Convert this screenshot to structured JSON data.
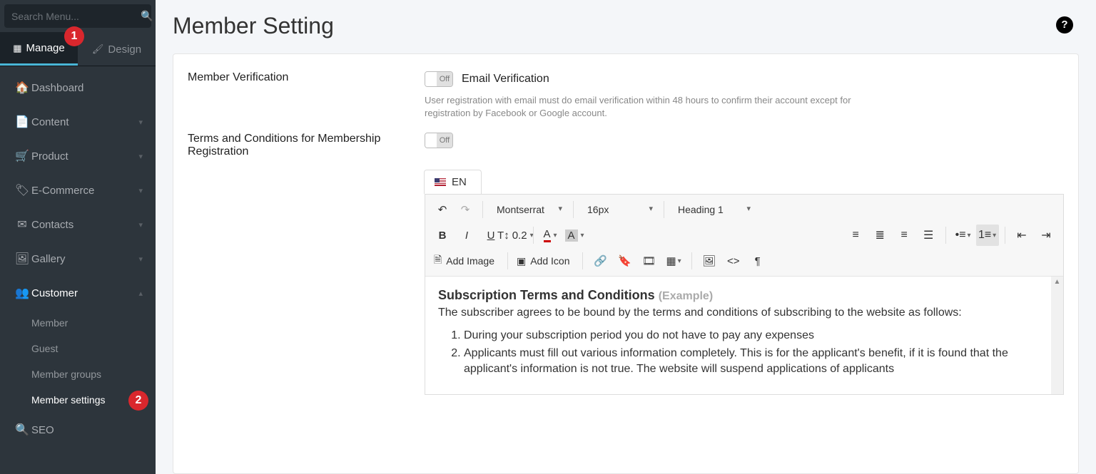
{
  "sidebar": {
    "search_placeholder": "Search Menu...",
    "tabs": {
      "manage": "Manage",
      "design": "Design",
      "badge1": "1"
    },
    "items": [
      {
        "icon": "home-icon",
        "label": "Dashboard",
        "caret": false
      },
      {
        "icon": "file-icon",
        "label": "Content",
        "caret": true
      },
      {
        "icon": "cart-icon",
        "label": "Product",
        "caret": true
      },
      {
        "icon": "tag-icon",
        "label": "E-Commerce",
        "caret": true
      },
      {
        "icon": "envelope-icon",
        "label": "Contacts",
        "caret": true
      },
      {
        "icon": "image-icon",
        "label": "Gallery",
        "caret": true
      },
      {
        "icon": "users-icon",
        "label": "Customer",
        "caret": true,
        "active": true
      },
      {
        "icon": "search-icon",
        "label": "SEO",
        "caret": false
      }
    ],
    "customer_sub": [
      {
        "label": "Member",
        "selected": false
      },
      {
        "label": "Guest",
        "selected": false
      },
      {
        "label": "Member groups",
        "selected": false
      },
      {
        "label": "Member settings",
        "selected": true,
        "badge": "2"
      }
    ]
  },
  "main": {
    "title": "Member Setting",
    "help": "?",
    "verify_label": "Member Verification",
    "verify_off": "Off",
    "verify_title": "Email Verification",
    "verify_desc": "User registration with email must do email verification within 48 hours to confirm their account except for registration by Facebook or Google account.",
    "terms_label": "Terms and Conditions for Membership Registration",
    "terms_off": "Off",
    "lang_tab": "EN"
  },
  "toolbar": {
    "font": "Montserrat",
    "size": "16px",
    "heading": "Heading 1",
    "letter": "0.2",
    "fontcolor": "A",
    "bgcolor": "A",
    "add_image": "Add Image",
    "add_icon": "Add Icon"
  },
  "editor": {
    "heading": "Subscription Terms and Conditions ",
    "example_open": "(",
    "example": "Example",
    "example_close": ")",
    "intro": "The subscriber agrees to be bound by the terms and conditions of subscribing to the website as follows:",
    "li1": "During your subscription period you do not have to pay any expenses",
    "li2": "Applicants must fill out various information completely. This is for the applicant's benefit, if it is found that the applicant's information is not true. The website will suspend applications of applicants"
  }
}
